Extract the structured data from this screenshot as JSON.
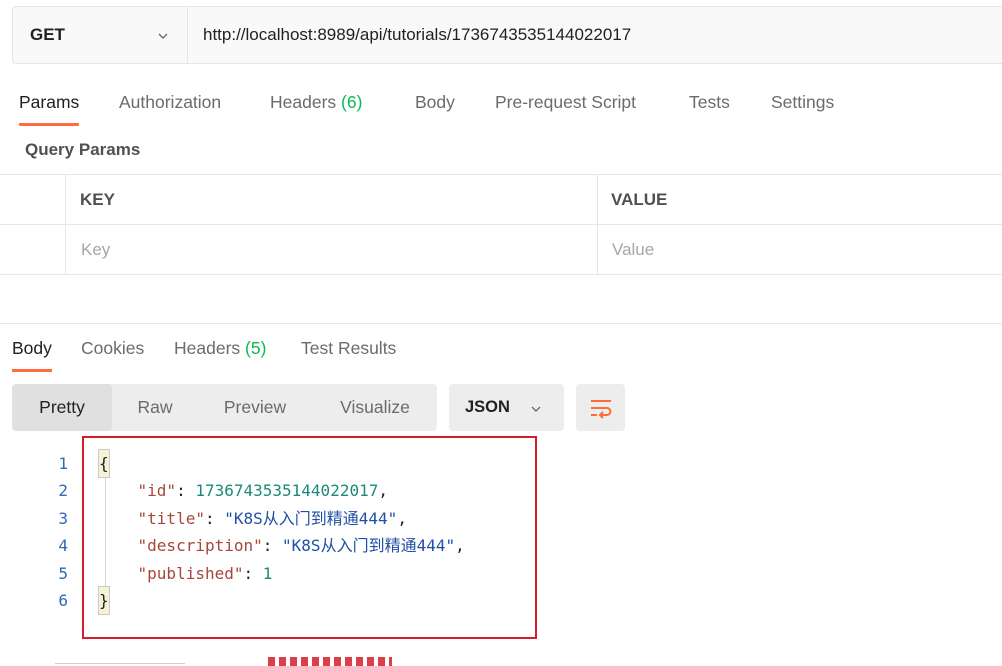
{
  "request": {
    "method": "GET",
    "url": "http://localhost:8989/api/tutorials/1736743535144022017"
  },
  "request_tabs": [
    {
      "label": "Params",
      "count": ""
    },
    {
      "label": "Authorization",
      "count": ""
    },
    {
      "label": "Headers ",
      "count": "(6)"
    },
    {
      "label": "Body",
      "count": ""
    },
    {
      "label": "Pre-request Script",
      "count": ""
    },
    {
      "label": "Tests",
      "count": ""
    },
    {
      "label": "Settings",
      "count": ""
    }
  ],
  "query_params": {
    "title": "Query Params",
    "columns": [
      "KEY",
      "VALUE"
    ],
    "placeholders": [
      "Key",
      "Value"
    ]
  },
  "response_tabs": [
    {
      "label": "Body",
      "count": ""
    },
    {
      "label": "Cookies",
      "count": ""
    },
    {
      "label": "Headers ",
      "count": "(5)"
    },
    {
      "label": "Test Results",
      "count": ""
    }
  ],
  "view_modes": [
    "Pretty",
    "Raw",
    "Preview",
    "Visualize"
  ],
  "format": "JSON",
  "icons": {
    "chevron": "chevron-down-icon",
    "wrap": "word-wrap-icon"
  },
  "colors": {
    "accent": "#ff6c37",
    "count": "#0cbb52",
    "highlight_box": "#d31d2a"
  },
  "response_body": {
    "line_numbers": [
      "1",
      "2",
      "3",
      "4",
      "5",
      "6"
    ],
    "open_brace": "{",
    "close_brace": "}",
    "fields": [
      {
        "key": "\"id\"",
        "value": "1736743535144022017",
        "type": "number",
        "comma": ","
      },
      {
        "key": "\"title\"",
        "value": "\"K8S从入门到精通444\"",
        "type": "string",
        "comma": ","
      },
      {
        "key": "\"description\"",
        "value": "\"K8S从入门到精通444\"",
        "type": "string",
        "comma": ","
      },
      {
        "key": "\"published\"",
        "value": "1",
        "type": "number",
        "comma": ""
      }
    ]
  }
}
